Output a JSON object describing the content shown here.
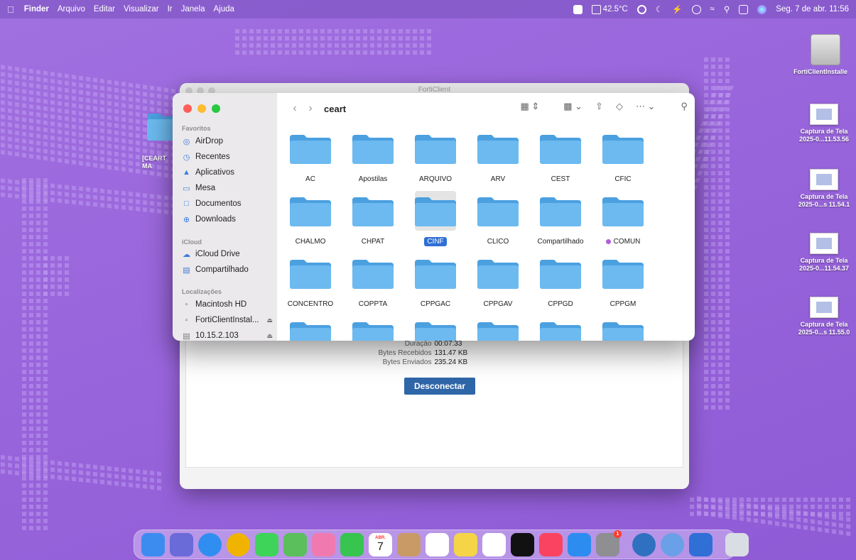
{
  "menubar": {
    "app": "Finder",
    "menus": [
      "Arquivo",
      "Editar",
      "Visualizar",
      "Ir",
      "Janela",
      "Ajuda"
    ],
    "temperature": "42.5°C",
    "datetime": "Seg. 7 de abr. 11:56"
  },
  "desktop": {
    "left_folder_label": "[CEART\nMA",
    "items": [
      {
        "label": "FortiClientInstalle",
        "kind": "drive"
      },
      {
        "label": "Captura de Tela\n2025-0...11.53.56",
        "kind": "screenshot"
      },
      {
        "label": "Captura de Tela\n2025-0...s 11.54.1",
        "kind": "screenshot"
      },
      {
        "label": "Captura de Tela\n2025-0...11.54.37",
        "kind": "screenshot"
      },
      {
        "label": "Captura de Tela\n2025-0...s 11.55.0",
        "kind": "screenshot"
      }
    ]
  },
  "forticlient": {
    "title": "FortiClient",
    "stats": [
      {
        "key": "Duração",
        "value": "00:07:33"
      },
      {
        "key": "Bytes Recebidos",
        "value": "131.47 KB"
      },
      {
        "key": "Bytes Enviados",
        "value": "235.24 KB"
      }
    ],
    "disconnect_label": "Desconectar"
  },
  "finder": {
    "folder_title": "ceart",
    "sidebar": {
      "favoritos_title": "Favoritos",
      "favoritos": [
        {
          "label": "AirDrop",
          "icon": "airdrop-icon"
        },
        {
          "label": "Recentes",
          "icon": "clock-icon"
        },
        {
          "label": "Aplicativos",
          "icon": "apps-icon"
        },
        {
          "label": "Mesa",
          "icon": "desktop-icon"
        },
        {
          "label": "Documentos",
          "icon": "document-icon"
        },
        {
          "label": "Downloads",
          "icon": "download-icon"
        }
      ],
      "icloud_title": "iCloud",
      "icloud": [
        {
          "label": "iCloud Drive",
          "icon": "cloud-icon"
        },
        {
          "label": "Compartilhado",
          "icon": "shared-folder-icon"
        }
      ],
      "locais_title": "Localizações",
      "locais": [
        {
          "label": "Macintosh HD",
          "icon": "disk-icon",
          "eject": false
        },
        {
          "label": "FortiClientInstal...",
          "icon": "disk-icon",
          "eject": true
        },
        {
          "label": "10.15.2.103",
          "icon": "network-icon",
          "eject": true
        }
      ]
    },
    "folders": [
      "AC",
      "Apostilas",
      "ARQUIVO",
      "ARV",
      "CEST",
      "CFIC",
      "CHALMO",
      "CHPAT",
      "CINF",
      "CLICO",
      "Compartilhado",
      "COMUN",
      "CONCENTRO",
      "COPPTA",
      "CPPGAC",
      "CPPGAV",
      "CPPGD",
      "CPPGM",
      "",
      "",
      "",
      "",
      "",
      ""
    ],
    "selected": "CINF",
    "tagged": {
      "COMUN": "#b05ee0"
    }
  },
  "dock": {
    "calendar_month": "ABR.",
    "calendar_day": "7",
    "settings_badge": "1",
    "apps": [
      {
        "name": "finder",
        "color": "#3c8cf0"
      },
      {
        "name": "launchpad",
        "color": "#6a6ad8"
      },
      {
        "name": "safari",
        "color": "#2f8ef0"
      },
      {
        "name": "chrome",
        "color": "#f0b400"
      },
      {
        "name": "messages",
        "color": "#3ed45a"
      },
      {
        "name": "maps",
        "color": "#5bbf5b"
      },
      {
        "name": "photos",
        "color": "#f07ab0"
      },
      {
        "name": "facetime",
        "color": "#37c44f"
      },
      {
        "name": "calendar",
        "color": "#ffffff"
      },
      {
        "name": "contacts",
        "color": "#c99a66"
      },
      {
        "name": "reminders",
        "color": "#ffffff"
      },
      {
        "name": "notes",
        "color": "#f5d547"
      },
      {
        "name": "freeform",
        "color": "#ffffff"
      },
      {
        "name": "tv",
        "color": "#111111"
      },
      {
        "name": "music",
        "color": "#fa4360"
      },
      {
        "name": "app-store",
        "color": "#2d8cf0"
      },
      {
        "name": "system-settings",
        "color": "#8e8e93"
      },
      {
        "name": "forticlient",
        "color": "#3070c0"
      },
      {
        "name": "other-app",
        "color": "#6aa0e8"
      },
      {
        "name": "vpn-shield",
        "color": "#2f6fd6"
      },
      {
        "name": "trash",
        "color": "#d9dde4"
      }
    ]
  },
  "colors": {
    "accent": "#2f6fd6",
    "folder_top": "#4ba0e0",
    "folder_body": "#6cbaf0"
  }
}
